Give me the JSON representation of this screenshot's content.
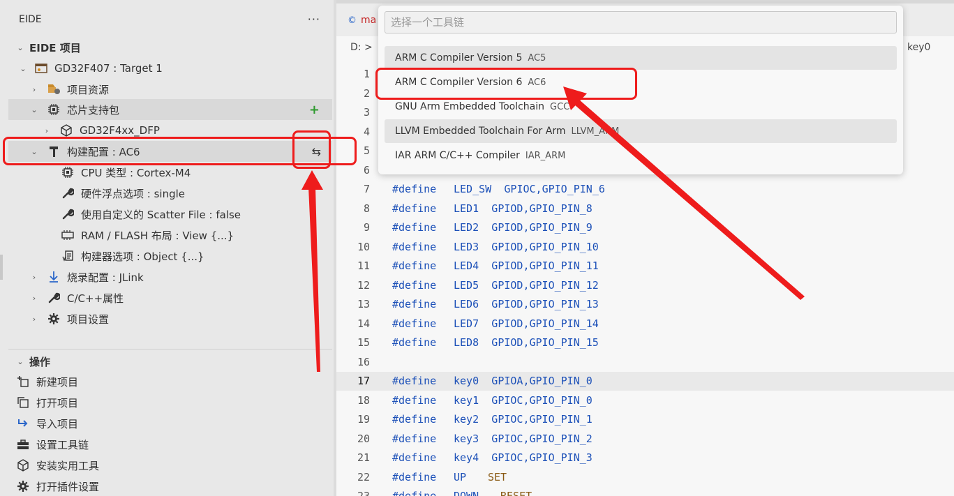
{
  "sidebar": {
    "panel_title": "EIDE",
    "more_label": "···",
    "project_section": "EIDE 项目",
    "project_name": "GD32F407 : Target 1",
    "tree": {
      "resources": "项目资源",
      "packs": "芯片支持包",
      "dfp": "GD32F4xx_DFP",
      "build_config": "构建配置 : AC6",
      "cpu_type": "CPU 类型 : Cortex-M4",
      "fpu": "硬件浮点选项 : single",
      "scatter": "使用自定义的 Scatter File : false",
      "ram_flash": "RAM / FLASH 布局 : View {...}",
      "builder_opts": "构建器选项 : Object {...}",
      "flash_config": "烧录配置 : JLink",
      "cpp_props": "C/C++属性",
      "project_settings": "项目设置"
    },
    "ops_section": "操作",
    "ops": {
      "new_project": "新建项目",
      "open_project": "打开项目",
      "import_project": "导入项目",
      "set_toolchain": "设置工具链",
      "install_tools": "安装实用工具",
      "plugin_settings": "打开插件设置"
    }
  },
  "editor": {
    "tab_label": "ma",
    "breadcrumb": "D: >",
    "breadcrumb_right": "key0",
    "lines": [
      {
        "n": "1",
        "kw": "",
        "name": "",
        "val": ""
      },
      {
        "n": "2",
        "kw": "",
        "name": "",
        "val": ""
      },
      {
        "n": "3",
        "kw": "",
        "name": "",
        "val": ""
      },
      {
        "n": "4",
        "kw": "",
        "name": "",
        "val": ""
      },
      {
        "n": "5",
        "kw": "",
        "name": "",
        "val": ""
      },
      {
        "n": "6",
        "kw": "",
        "name": "",
        "val": ""
      },
      {
        "n": "7",
        "kw": "#define",
        "name": "LED_SW",
        "val": "GPIOC,GPIO_PIN_6"
      },
      {
        "n": "8",
        "kw": "#define",
        "name": "LED1",
        "val": "GPIOD,GPIO_PIN_8"
      },
      {
        "n": "9",
        "kw": "#define",
        "name": "LED2",
        "val": "GPIOD,GPIO_PIN_9"
      },
      {
        "n": "10",
        "kw": "#define",
        "name": "LED3",
        "val": "GPIOD,GPIO_PIN_10"
      },
      {
        "n": "11",
        "kw": "#define",
        "name": "LED4",
        "val": "GPIOD,GPIO_PIN_11"
      },
      {
        "n": "12",
        "kw": "#define",
        "name": "LED5",
        "val": "GPIOD,GPIO_PIN_12"
      },
      {
        "n": "13",
        "kw": "#define",
        "name": "LED6",
        "val": "GPIOD,GPIO_PIN_13"
      },
      {
        "n": "14",
        "kw": "#define",
        "name": "LED7",
        "val": "GPIOD,GPIO_PIN_14"
      },
      {
        "n": "15",
        "kw": "#define",
        "name": "LED8",
        "val": "GPIOD,GPIO_PIN_15"
      },
      {
        "n": "16",
        "kw": "",
        "name": "",
        "val": ""
      },
      {
        "n": "17",
        "kw": "#define",
        "name": "key0",
        "val": "GPIOA,GPIO_PIN_0"
      },
      {
        "n": "18",
        "kw": "#define",
        "name": "key1",
        "val": "GPIOC,GPIO_PIN_0"
      },
      {
        "n": "19",
        "kw": "#define",
        "name": "key2",
        "val": "GPIOC,GPIO_PIN_1"
      },
      {
        "n": "20",
        "kw": "#define",
        "name": "key3",
        "val": "GPIOC,GPIO_PIN_2"
      },
      {
        "n": "21",
        "kw": "#define",
        "name": "key4",
        "val": "GPIOC,GPIO_PIN_3"
      },
      {
        "n": "22",
        "kw": "#define",
        "name": "UP",
        "val": "SET"
      },
      {
        "n": "23",
        "kw": "#define",
        "name": "DOWN",
        "val": "RESET"
      }
    ]
  },
  "quickpick": {
    "placeholder": "选择一个工具链",
    "items": [
      {
        "label": "ARM C Compiler Version 5",
        "desc": "AC5"
      },
      {
        "label": "ARM C Compiler Version 6",
        "desc": "AC6"
      },
      {
        "label": "GNU Arm Embedded Toolchain",
        "desc": "GCC"
      },
      {
        "label": "LLVM Embedded Toolchain For Arm",
        "desc": "LLVM_ARM"
      },
      {
        "label": "IAR ARM C/C++ Compiler",
        "desc": "IAR_ARM"
      }
    ]
  },
  "colors": {
    "annotation_red": "#ee1c1c",
    "add_green": "#2e9a2e",
    "keyword_blue": "#1c50b8",
    "value_brown": "#8a5a14"
  },
  "icons": {
    "project": "project-icon",
    "resources": "resources-icon",
    "chip": "chip-icon",
    "package": "package-icon",
    "hammer": "hammer-icon",
    "swap": "swap-icon",
    "wrench": "wrench-icon",
    "memory": "memory-icon",
    "builder": "builder-options-icon",
    "download": "download-arrow-icon",
    "gear": "gear-icon"
  }
}
